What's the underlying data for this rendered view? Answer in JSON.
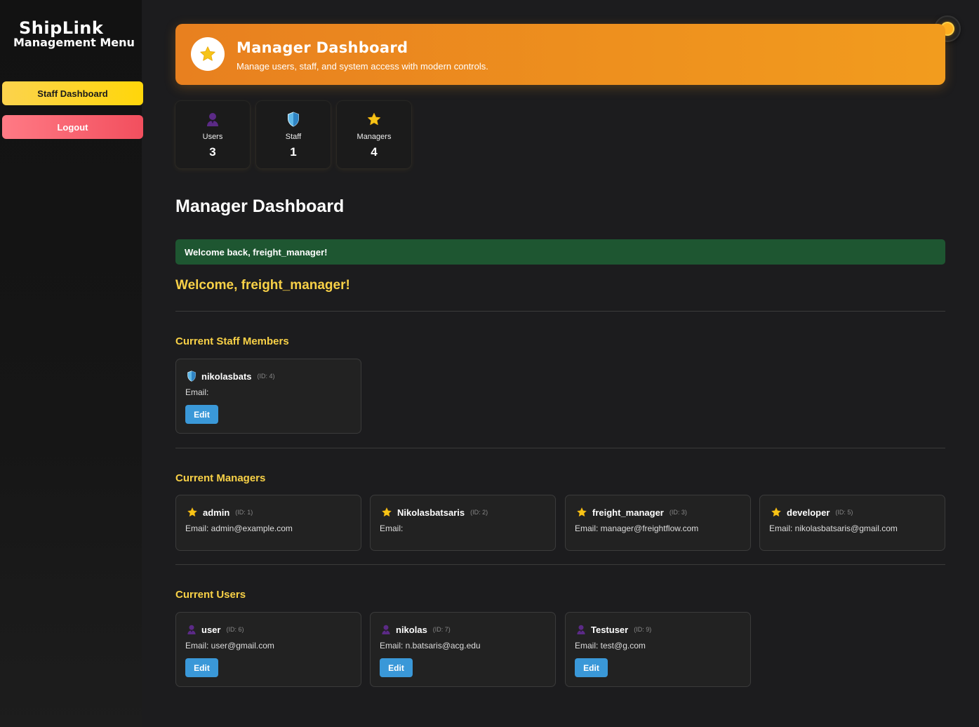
{
  "sidebar": {
    "brand": "ShipLink",
    "subtitle": "Management Menu",
    "staff_dashboard_label": "Staff Dashboard",
    "logout_label": "Logout"
  },
  "header": {
    "title": "Manager Dashboard",
    "subtitle": "Manage users, staff, and system access with modern controls."
  },
  "stats": [
    {
      "label": "Users",
      "value": "3",
      "icon": "user-icon"
    },
    {
      "label": "Staff",
      "value": "1",
      "icon": "shield-icon"
    },
    {
      "label": "Managers",
      "value": "4",
      "icon": "star-icon"
    }
  ],
  "main": {
    "page_title": "Manager Dashboard",
    "flash_message": "Welcome back, freight_manager!",
    "welcome_text": "Welcome, freight_manager!"
  },
  "staff_section": {
    "title": "Current Staff Members",
    "members": [
      {
        "name": "nikolasbats",
        "id": "(ID: 4)",
        "email": "Email:",
        "edit_label": "Edit"
      }
    ]
  },
  "managers_section": {
    "title": "Current Managers",
    "members": [
      {
        "name": "admin",
        "id": "(ID: 1)",
        "email": "Email: admin@example.com"
      },
      {
        "name": "Nikolasbatsaris",
        "id": "(ID: 2)",
        "email": "Email:"
      },
      {
        "name": "freight_manager",
        "id": "(ID: 3)",
        "email": "Email: manager@freightflow.com"
      },
      {
        "name": "developer",
        "id": "(ID: 5)",
        "email": "Email: nikolasbatsaris@gmail.com"
      }
    ]
  },
  "users_section": {
    "title": "Current Users",
    "members": [
      {
        "name": "user",
        "id": "(ID: 6)",
        "email": "Email: user@gmail.com",
        "edit_label": "Edit"
      },
      {
        "name": "nikolas",
        "id": "(ID: 7)",
        "email": "Email: n.batsaris@acg.edu",
        "edit_label": "Edit"
      },
      {
        "name": "Testuser",
        "id": "(ID: 9)",
        "email": "Email: test@g.com",
        "edit_label": "Edit"
      }
    ]
  },
  "colors": {
    "accent_orange": "#f29c1e",
    "accent_yellow": "#f8d147",
    "success_green": "#1e5631",
    "edit_blue": "#3a98d8",
    "logout_red": "#f24f5e"
  }
}
